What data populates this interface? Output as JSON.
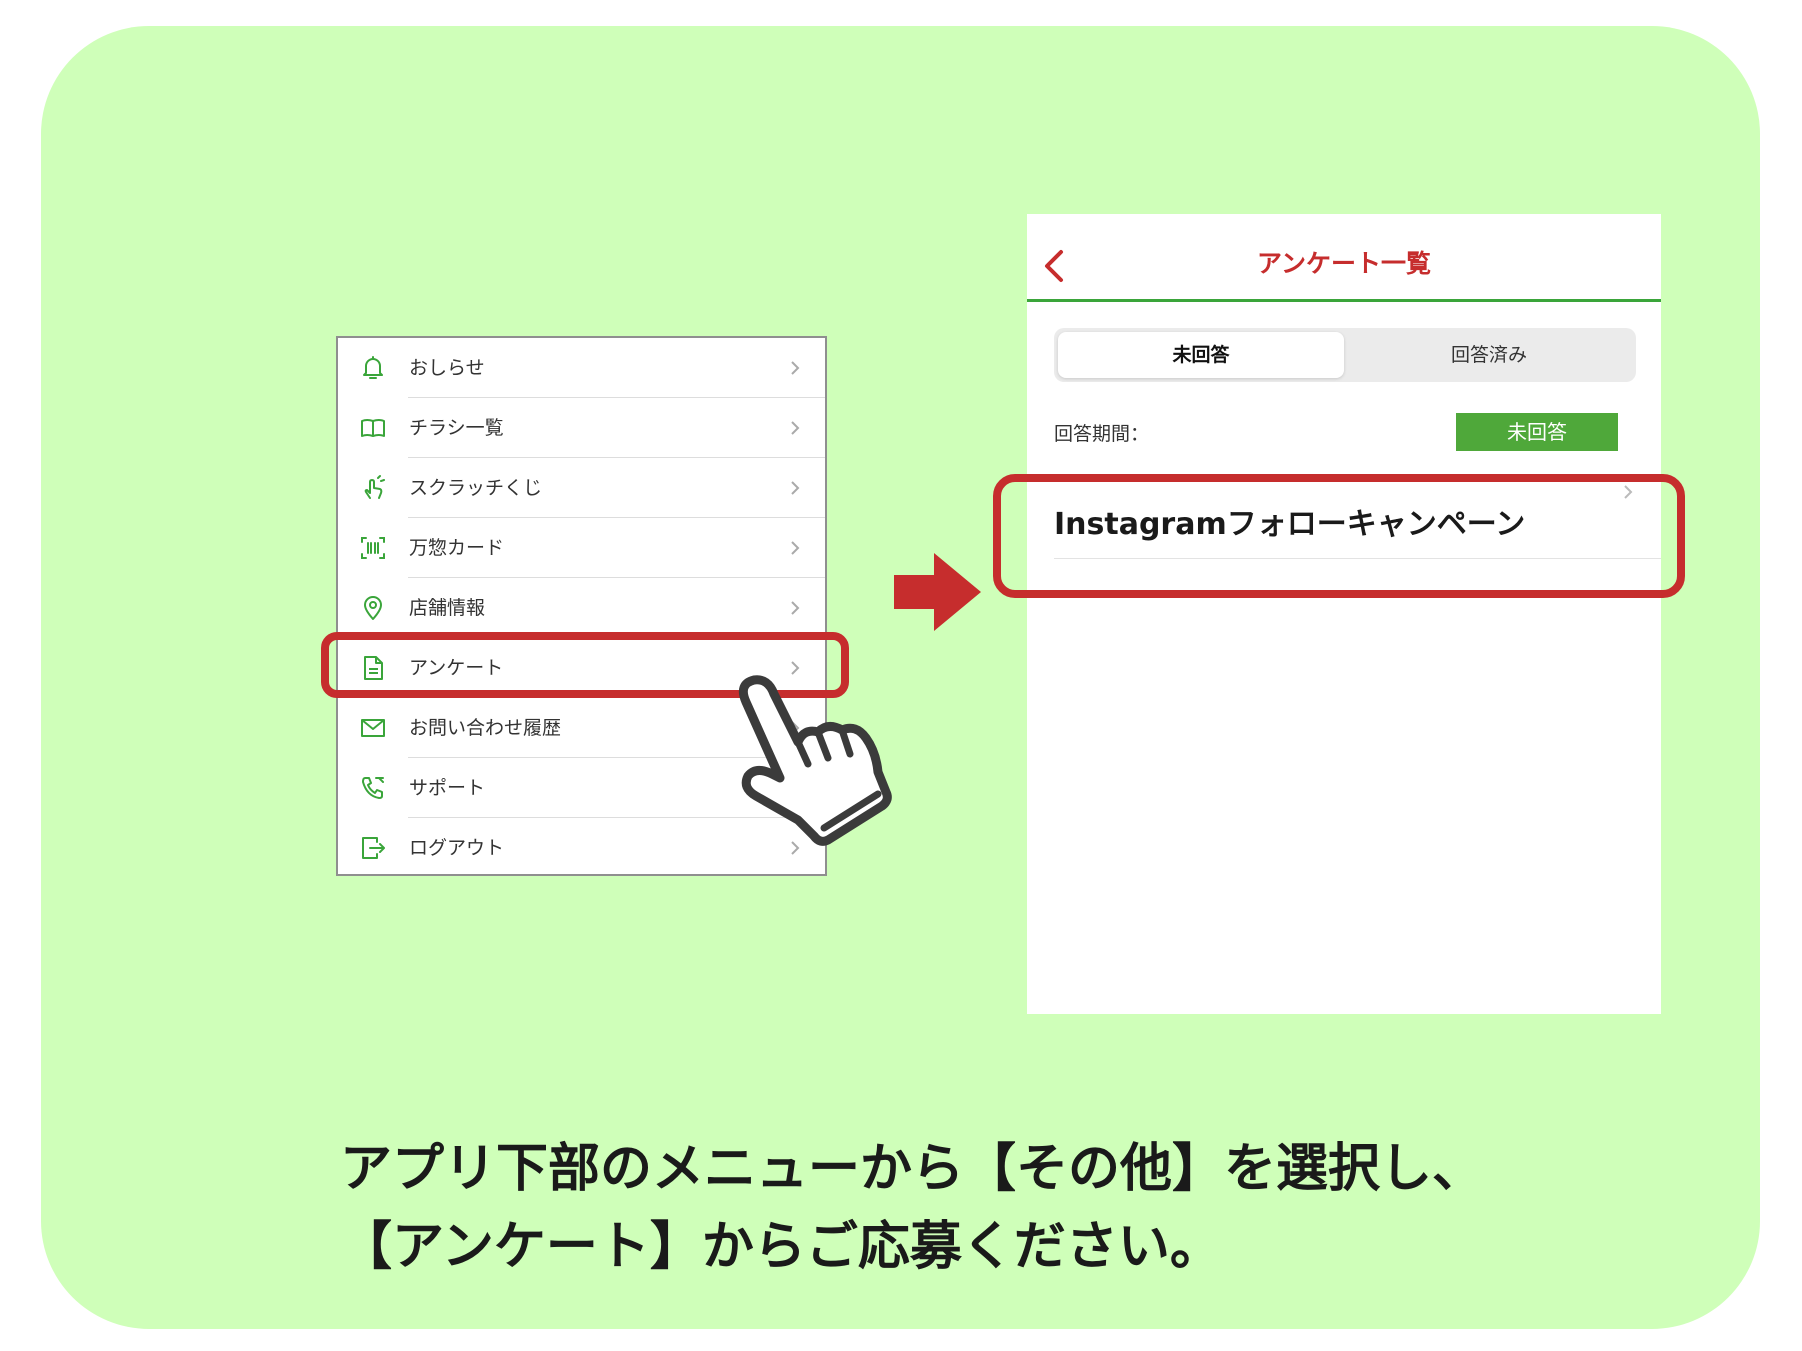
{
  "colors": {
    "background_panel": "#cfffb9",
    "accent_red": "#c62d2d",
    "accent_green": "#3aa53a",
    "badge_green": "#4fa83a"
  },
  "menu": {
    "items": [
      {
        "label": "おしらせ",
        "icon": "bell-icon"
      },
      {
        "label": "チラシ一覧",
        "icon": "book-icon"
      },
      {
        "label": "スクラッチくじ",
        "icon": "scratch-finger-icon"
      },
      {
        "label": "万惣カード",
        "icon": "barcode-scan-icon"
      },
      {
        "label": "店舗情報",
        "icon": "map-pin-icon"
      },
      {
        "label": "アンケート",
        "icon": "document-icon"
      },
      {
        "label": "お問い合わせ履歴",
        "icon": "mail-icon"
      },
      {
        "label": "サポート",
        "icon": "phone-icon"
      },
      {
        "label": "ログアウト",
        "icon": "logout-icon"
      }
    ]
  },
  "survey_screen": {
    "title": "アンケート一覧",
    "tabs": [
      {
        "label": "未回答",
        "active": true
      },
      {
        "label": "回答済み",
        "active": false
      }
    ],
    "period_label": "回答期間：",
    "status_badge": "未回答",
    "item_title": "Instagramフォローキャンペーン"
  },
  "caption": {
    "line1": "アプリ下部のメニューから【その他】を選択し、",
    "line2": "【アンケート】からご応募ください。"
  }
}
